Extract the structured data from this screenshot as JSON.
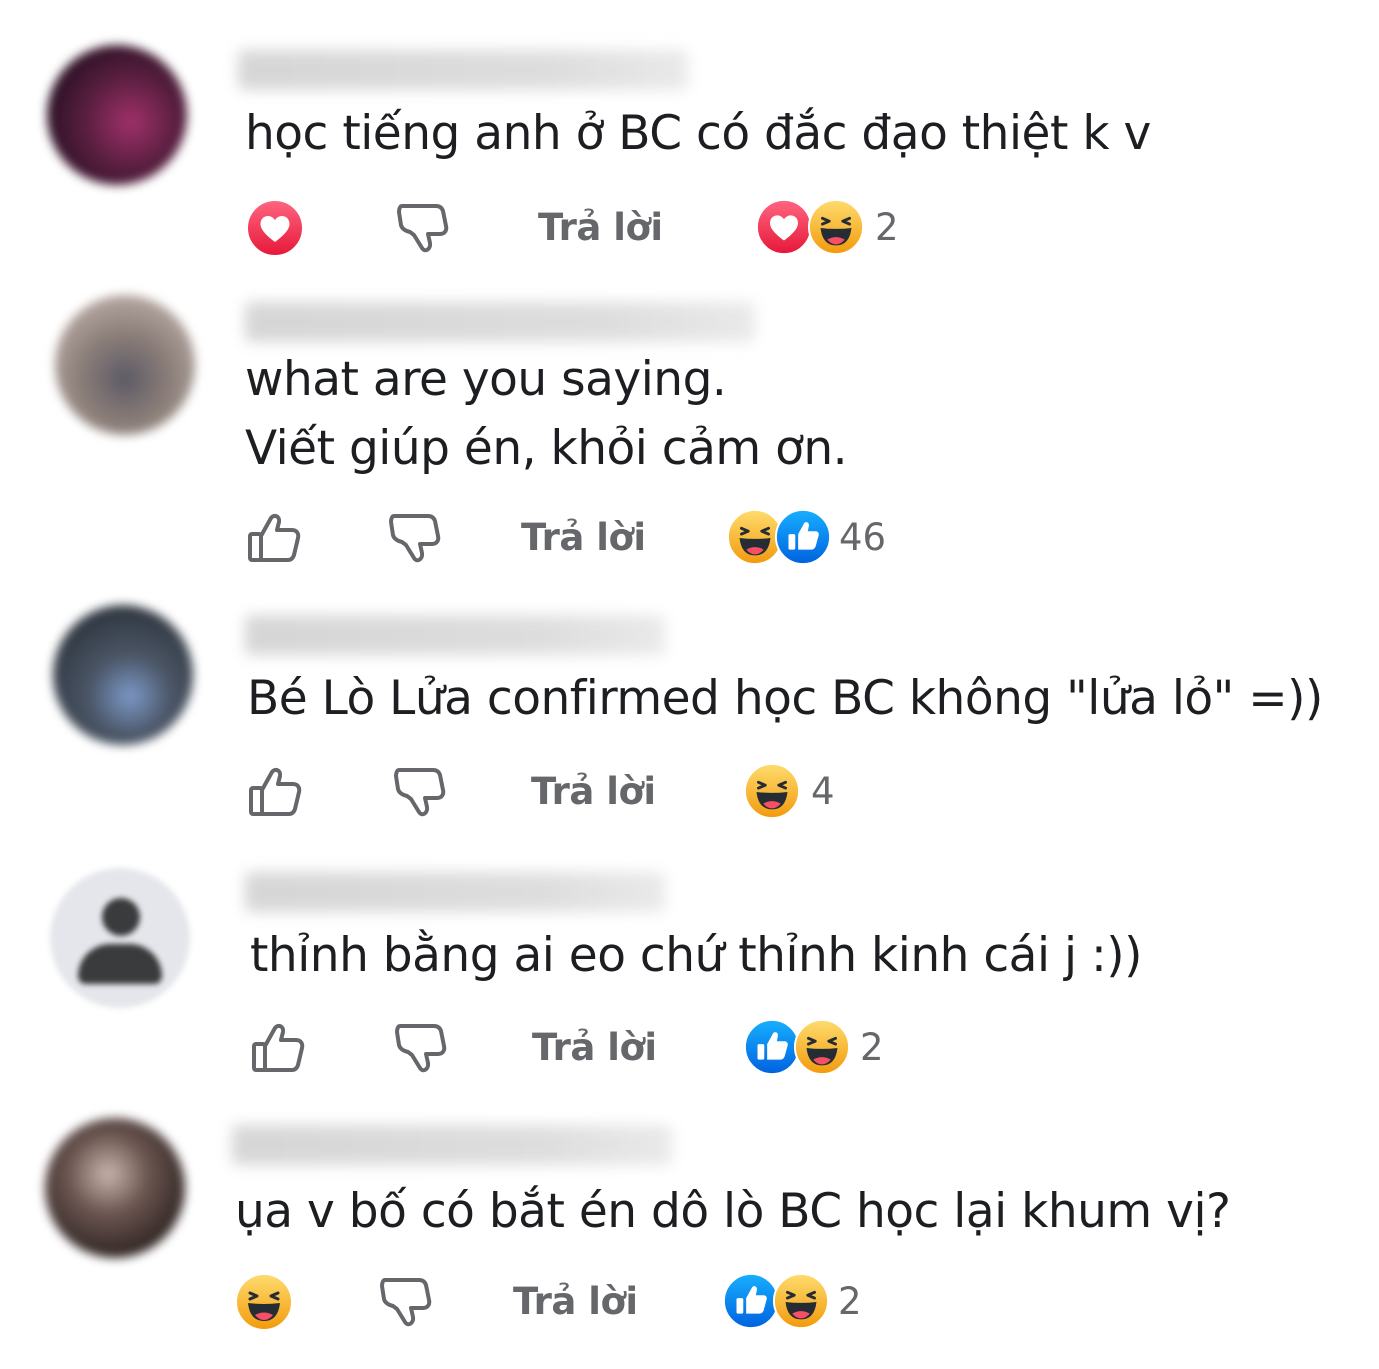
{
  "actions": {
    "reply_label": "Trả lời"
  },
  "comments": [
    {
      "lines": [
        "học tiếng anh ở BC có đắc đạo thiệt k v"
      ],
      "reaction_count": "2",
      "own_reaction": "love-icon",
      "summary_icons": [
        "love-icon",
        "haha-icon"
      ]
    },
    {
      "lines": [
        "what are you saying.",
        "Viết giúp én, khỏi cảm ơn."
      ],
      "reaction_count": "46",
      "own_reaction": "like-outline-icon",
      "summary_icons": [
        "haha-icon",
        "like-icon"
      ]
    },
    {
      "lines": [
        "Bé Lò Lửa confirmed học BC không \"lửa lỏ\" =))"
      ],
      "reaction_count": "4",
      "own_reaction": "like-outline-icon",
      "summary_icons": [
        "haha-icon"
      ]
    },
    {
      "lines": [
        "thỉnh bằng ai eo chứ thỉnh kinh cái j :))"
      ],
      "reaction_count": "2",
      "own_reaction": "like-outline-icon",
      "summary_icons": [
        "like-icon",
        "haha-icon"
      ]
    },
    {
      "lines": [
        "ụa v bố có bắt én dô lò BC học lại khum vị?"
      ],
      "reaction_count": "2",
      "own_reaction": "haha-icon",
      "summary_icons": [
        "like-icon",
        "haha-icon"
      ]
    }
  ],
  "colors": {
    "love": "#f33e58",
    "like": "#1877f2",
    "haha": "#f7b125",
    "secondary_text": "#65676b"
  }
}
